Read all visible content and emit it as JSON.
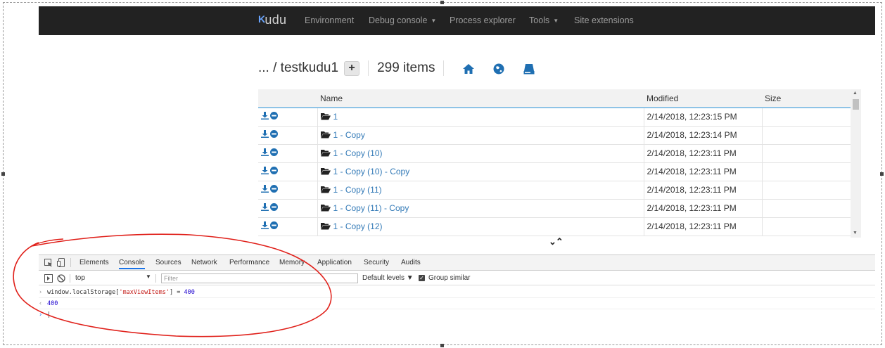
{
  "navbar": {
    "brand": "Kudu",
    "items": [
      {
        "label": "Environment",
        "dropdown": false
      },
      {
        "label": "Debug console",
        "dropdown": true
      },
      {
        "label": "Process explorer",
        "dropdown": false
      },
      {
        "label": "Tools",
        "dropdown": true
      },
      {
        "label": "Site extensions",
        "dropdown": false
      }
    ]
  },
  "breadcrumb": {
    "path": "... / testkudu1",
    "add_label": "+",
    "item_count": "299 items",
    "icons": [
      "home-icon",
      "globe-icon",
      "drive-icon"
    ]
  },
  "table": {
    "columns": [
      "Name",
      "Modified",
      "Size"
    ],
    "rows": [
      {
        "name": "1",
        "modified": "2/14/2018, 12:23:15 PM",
        "size": ""
      },
      {
        "name": "1 - Copy",
        "modified": "2/14/2018, 12:23:14 PM",
        "size": ""
      },
      {
        "name": "1 - Copy (10)",
        "modified": "2/14/2018, 12:23:11 PM",
        "size": ""
      },
      {
        "name": "1 - Copy (10) - Copy",
        "modified": "2/14/2018, 12:23:11 PM",
        "size": ""
      },
      {
        "name": "1 - Copy (11)",
        "modified": "2/14/2018, 12:23:11 PM",
        "size": ""
      },
      {
        "name": "1 - Copy (11) - Copy",
        "modified": "2/14/2018, 12:23:11 PM",
        "size": ""
      },
      {
        "name": "1 - Copy (12)",
        "modified": "2/14/2018, 12:23:11 PM",
        "size": ""
      }
    ],
    "expand_toggle": "⌄⌃"
  },
  "devtools": {
    "tabs": [
      "Elements",
      "Console",
      "Sources",
      "Network",
      "Performance",
      "Memory",
      "Application",
      "Security",
      "Audits"
    ],
    "active_tab": "Console",
    "context": "top",
    "filter_placeholder": "Filter",
    "levels_label": "Default levels ▼",
    "group_similar": "Group similar",
    "group_similar_checked": true,
    "console": {
      "input_prefix": "window.localStorage[",
      "input_key": "'maxViewItems'",
      "input_suffix": "] = ",
      "input_value": "400",
      "result": "400",
      "prompt": "|"
    }
  },
  "colors": {
    "navbar_bg": "#222222",
    "link": "#337ab7",
    "icon_blue": "#1f6fb2",
    "annotation": "#e0201a"
  }
}
